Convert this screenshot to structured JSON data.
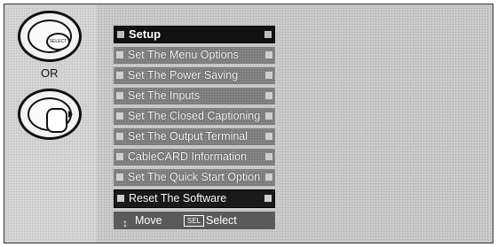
{
  "remote": {
    "top_button_label": "SELECT",
    "or_text": "OR"
  },
  "menu": {
    "title": "Setup",
    "items": [
      {
        "label": "Set The Menu Options"
      },
      {
        "label": "Set The Power Saving"
      },
      {
        "label": "Set The Inputs"
      },
      {
        "label": "Set The Closed Captioning"
      },
      {
        "label": "Set The Output Terminal"
      },
      {
        "label": "CableCARD Information"
      },
      {
        "label": "Set The Quick Start Option"
      },
      {
        "label": "Reset The Software"
      }
    ],
    "selected_index": 7
  },
  "footer": {
    "move_icon": "↕",
    "move_label": "Move",
    "select_badge": "SEL",
    "select_label": "Select"
  }
}
